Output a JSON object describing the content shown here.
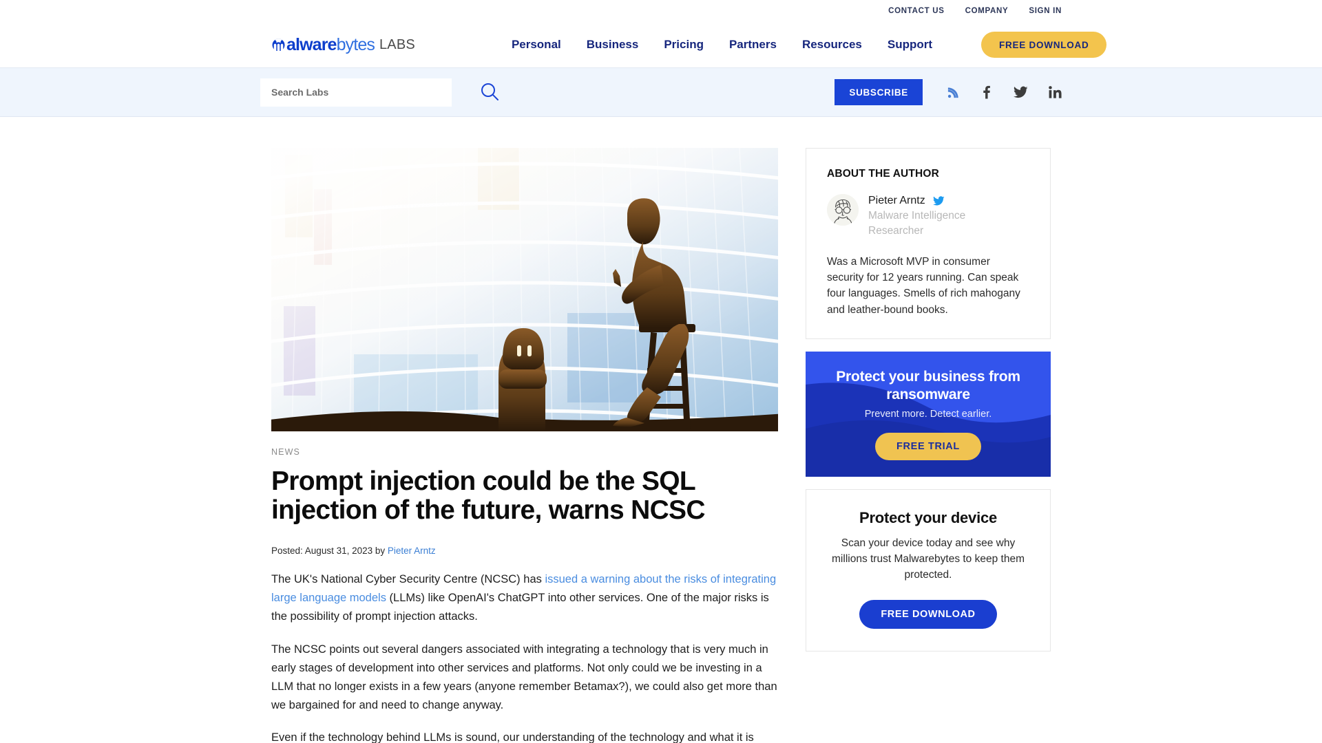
{
  "brand": {
    "logo_name_part1": "alware",
    "logo_name_part2": "bytes",
    "logo_suffix": "LABS",
    "accent_blue": "#0d3ecc",
    "accent_light_blue": "#2f6fe0",
    "accent_yellow": "#f3c44d",
    "nav_navy": "#16267d"
  },
  "utility_nav": {
    "items": [
      {
        "label": "CONTACT US"
      },
      {
        "label": "COMPANY"
      },
      {
        "label": "SIGN IN"
      }
    ]
  },
  "main_nav": {
    "items": [
      {
        "label": "Personal"
      },
      {
        "label": "Business"
      },
      {
        "label": "Pricing"
      },
      {
        "label": "Partners"
      },
      {
        "label": "Resources"
      },
      {
        "label": "Support"
      }
    ],
    "cta_label": "FREE DOWNLOAD"
  },
  "search": {
    "placeholder": "Search Labs",
    "value": "",
    "submit_icon": "search-icon",
    "subscribe_label": "SUBSCRIBE",
    "social": [
      {
        "name": "rss-icon"
      },
      {
        "name": "facebook-icon"
      },
      {
        "name": "twitter-icon"
      },
      {
        "name": "linkedin-icon"
      }
    ]
  },
  "article": {
    "category": "NEWS",
    "title": "Prompt injection could be the SQL injection of the future, warns NCSC",
    "posted_prefix": "Posted: ",
    "posted_date": "August 31, 2023",
    "posted_by": " by ",
    "author": "Pieter Arntz",
    "hero_alt": "Silhouette of a person seated on a stool using a tablet facing a robot figure against a bright curved glass building",
    "paragraphs": [
      {
        "segments": [
          {
            "text": "The UK's National Cyber Security Centre (NCSC) has ",
            "link": false
          },
          {
            "text": "issued a warning about the risks of integrating large language models",
            "link": true
          },
          {
            "text": " (LLMs) like OpenAI's ChatGPT into other services. One of the major risks is the possibility of prompt injection attacks.",
            "link": false
          }
        ]
      },
      {
        "segments": [
          {
            "text": "The NCSC points out several dangers associated with integrating a technology that is very much in early stages of development into other services and platforms. Not only could we be investing in a LLM that no longer exists in a few years (anyone remember Betamax?), we could also get more than we bargained for and need to change anyway.",
            "link": false
          }
        ]
      },
      {
        "segments": [
          {
            "text": "Even if the technology behind LLMs is sound, our understanding of the technology and what it is",
            "link": false
          }
        ]
      }
    ]
  },
  "sidebar": {
    "author_card": {
      "title": "ABOUT THE AUTHOR",
      "avatar_icon": "author-avatar",
      "name": "Pieter Arntz",
      "twitter_icon": "twitter-icon",
      "role": "Malware Intelligence Researcher",
      "bio": "Was a Microsoft MVP in consumer security for 12 years running. Can speak four languages. Smells of rich mahogany and leather-bound books."
    },
    "business_promo": {
      "heading": "Protect your business from ransomware",
      "subheading": "Prevent more. Detect earlier.",
      "cta_label": "FREE TRIAL",
      "bg_color": "#3354ec",
      "wave_color": "#1b33b8",
      "cta_color": "#f0c351"
    },
    "device_promo": {
      "heading": "Protect your device",
      "body": "Scan your device today and see why millions trust Malwarebytes to keep them protected.",
      "cta_label": "FREE DOWNLOAD",
      "cta_color": "#1a3ed0"
    }
  }
}
